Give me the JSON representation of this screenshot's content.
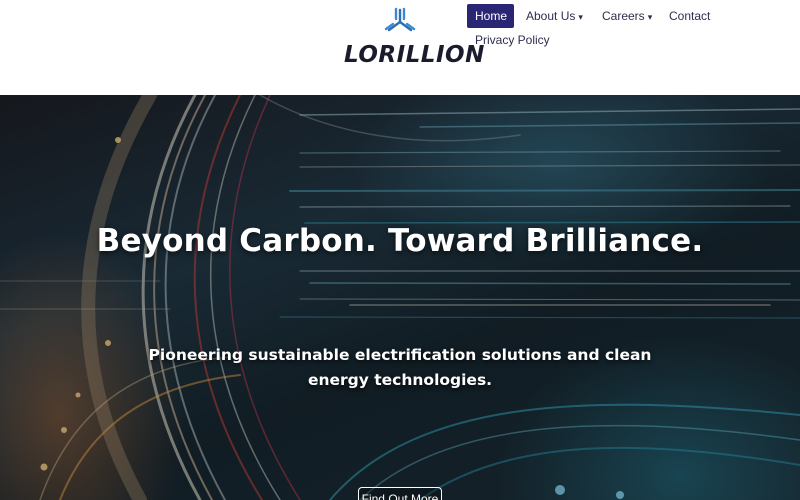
{
  "brand": {
    "name": "LORILLION",
    "logo_color": "#1b1b2e",
    "mark_color": "#2a6fb5"
  },
  "nav": {
    "items": [
      {
        "label": "Home",
        "active": true
      },
      {
        "label": "About Us",
        "has_dropdown": true
      },
      {
        "label": "Careers",
        "has_dropdown": true
      },
      {
        "label": "Contact"
      },
      {
        "label": "Privacy Policy"
      }
    ],
    "dropdown_glyph": "▾",
    "active_color": "#2a2673"
  },
  "hero": {
    "title": "Beyond Carbon. Toward Brilliance.",
    "subtitle": "Pioneering sustainable electrification solutions and clean energy technologies.",
    "button_label": "Find Out More",
    "background_description_icon": "highway-light-trails-image"
  }
}
